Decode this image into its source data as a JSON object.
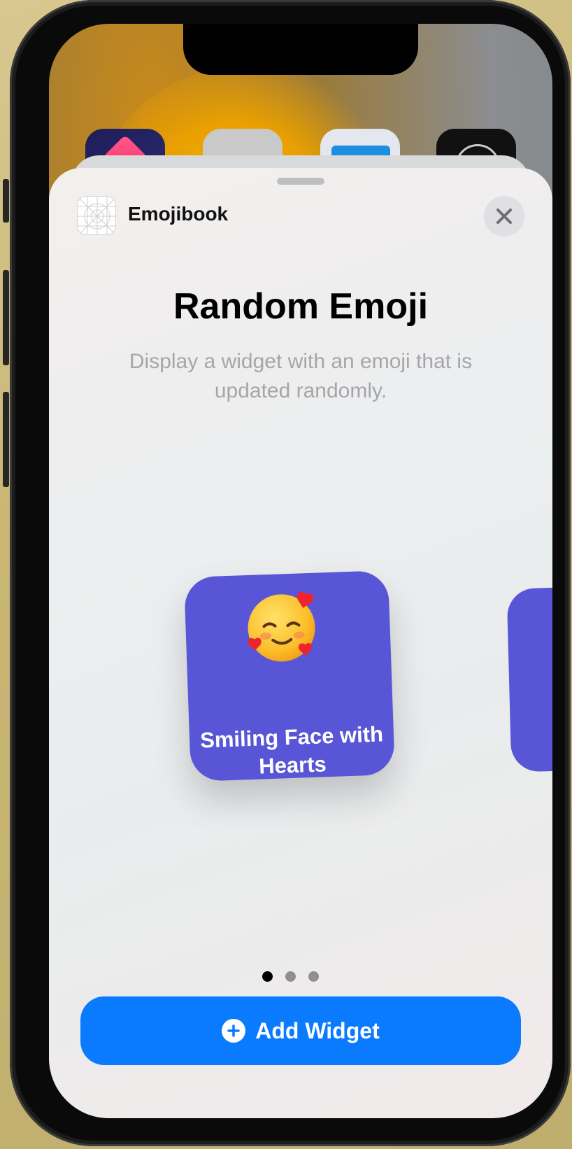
{
  "sheet": {
    "app_name": "Emojibook",
    "title": "Random Emoji",
    "subtitle": "Display a widget with an emoji that is updated randomly.",
    "add_button_label": "Add Widget",
    "page_dots": {
      "count": 3,
      "active_index": 0
    }
  },
  "widget": {
    "emoji_name": "smiling-face-with-hearts",
    "label": "Smiling Face with Hearts",
    "background_color": "#5856d6"
  },
  "colors": {
    "accent": "#0a7aff",
    "close_button_bg": "#dfe0e3",
    "subtitle_text": "#a6a6aa"
  }
}
